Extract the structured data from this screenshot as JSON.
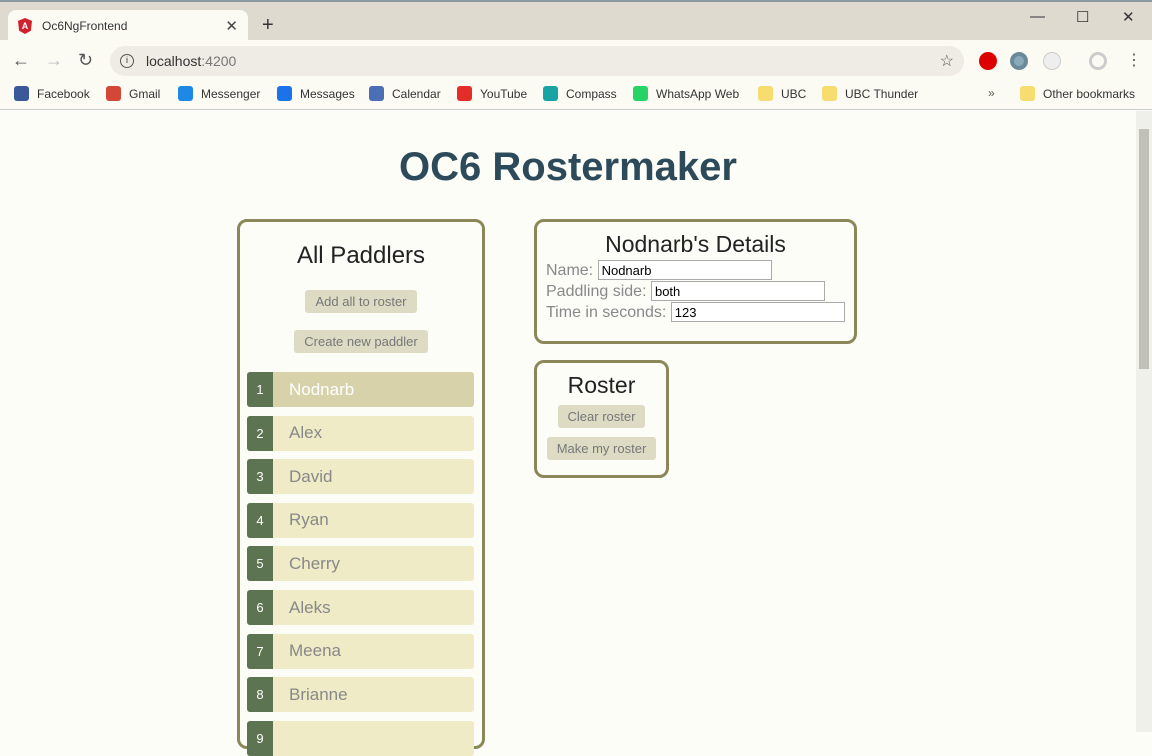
{
  "browser": {
    "tab_title": "Oc6NgFrontend",
    "url_host": "localhost",
    "url_port": ":4200",
    "bookmarks": [
      {
        "label": "Facebook",
        "color": "#3b5998"
      },
      {
        "label": "Gmail",
        "color": "#d44638"
      },
      {
        "label": "Messenger",
        "color": "#1e88e5"
      },
      {
        "label": "Messages",
        "color": "#1a73e8"
      },
      {
        "label": "Calendar",
        "color": "#4a6fb5"
      },
      {
        "label": "YouTube",
        "color": "#e52d27"
      },
      {
        "label": "Compass",
        "color": "#1aa3a3"
      },
      {
        "label": "WhatsApp Web",
        "color": "#25d366"
      },
      {
        "label": "UBC",
        "color": "#f7dc6f"
      },
      {
        "label": "UBC Thunder",
        "color": "#f7dc6f"
      }
    ],
    "overflow": "»",
    "other_bookmarks": "Other bookmarks"
  },
  "page": {
    "title": "OC6 Rostermaker",
    "all_paddlers": {
      "heading": "All Paddlers",
      "add_all": "Add all to roster",
      "create_new": "Create new paddler",
      "paddlers": [
        {
          "num": "1",
          "name": "Nodnarb",
          "selected": true
        },
        {
          "num": "2",
          "name": "Alex"
        },
        {
          "num": "3",
          "name": "David"
        },
        {
          "num": "4",
          "name": "Ryan"
        },
        {
          "num": "5",
          "name": "Cherry"
        },
        {
          "num": "6",
          "name": "Aleks"
        },
        {
          "num": "7",
          "name": "Meena"
        },
        {
          "num": "8",
          "name": "Brianne"
        },
        {
          "num": "9",
          "name": ""
        }
      ]
    },
    "details": {
      "heading": "Nodnarb's Details",
      "name_label": "Name:",
      "name_value": "Nodnarb",
      "side_label": "Paddling side:",
      "side_value": "both",
      "time_label": "Time in seconds:",
      "time_value": "123"
    },
    "roster": {
      "heading": "Roster",
      "clear": "Clear roster",
      "make": "Make my roster"
    }
  }
}
